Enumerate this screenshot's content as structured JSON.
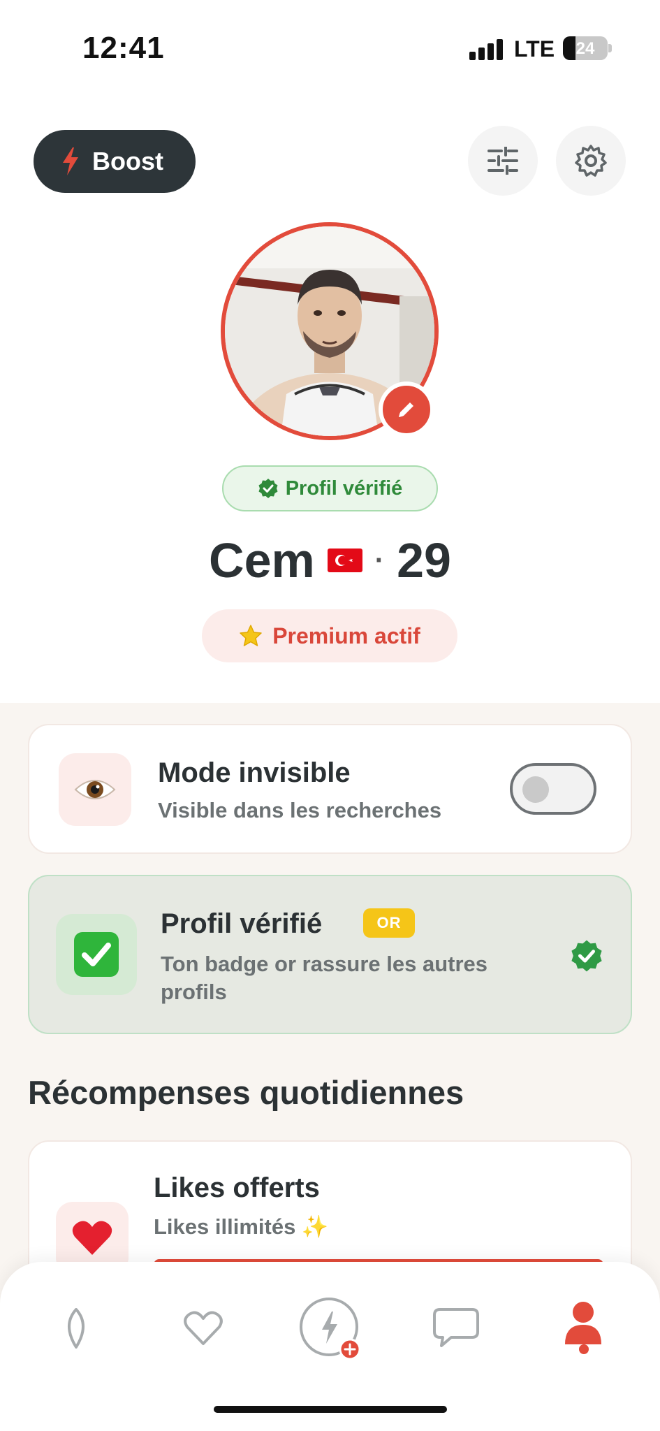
{
  "status_bar": {
    "time": "12:41",
    "network": "LTE",
    "battery": "24"
  },
  "header": {
    "boost_label": "Boost",
    "filters_icon": "sliders-icon",
    "settings_icon": "gear-icon"
  },
  "profile": {
    "verified_label": "Profil vérifié",
    "name": "Cem",
    "flag": "Turkey flag",
    "separator": "·",
    "age": "29",
    "premium_label": "Premium actif"
  },
  "cards": {
    "invisible": {
      "title": "Mode invisible",
      "subtitle": "Visible dans les recherches",
      "toggle_on": false
    },
    "verified": {
      "title": "Profil vérifié",
      "badge": "OR",
      "subtitle_line1": "Ton badge or rassure les autres",
      "subtitle_line2": "profils"
    }
  },
  "rewards": {
    "section_title": "Récompenses quotidiennes",
    "likes": {
      "title": "Likes offerts",
      "subtitle": "Likes illimités ✨"
    }
  },
  "tab_bar": {
    "tabs": [
      "discover-icon",
      "heart-icon",
      "boost-icon",
      "chat-icon",
      "profile-icon"
    ],
    "active": "profile-icon"
  },
  "colors": {
    "accent": "#e24b3b",
    "dark": "#2d3539",
    "success": "#2f8a3a",
    "gold": "#f5c518"
  }
}
